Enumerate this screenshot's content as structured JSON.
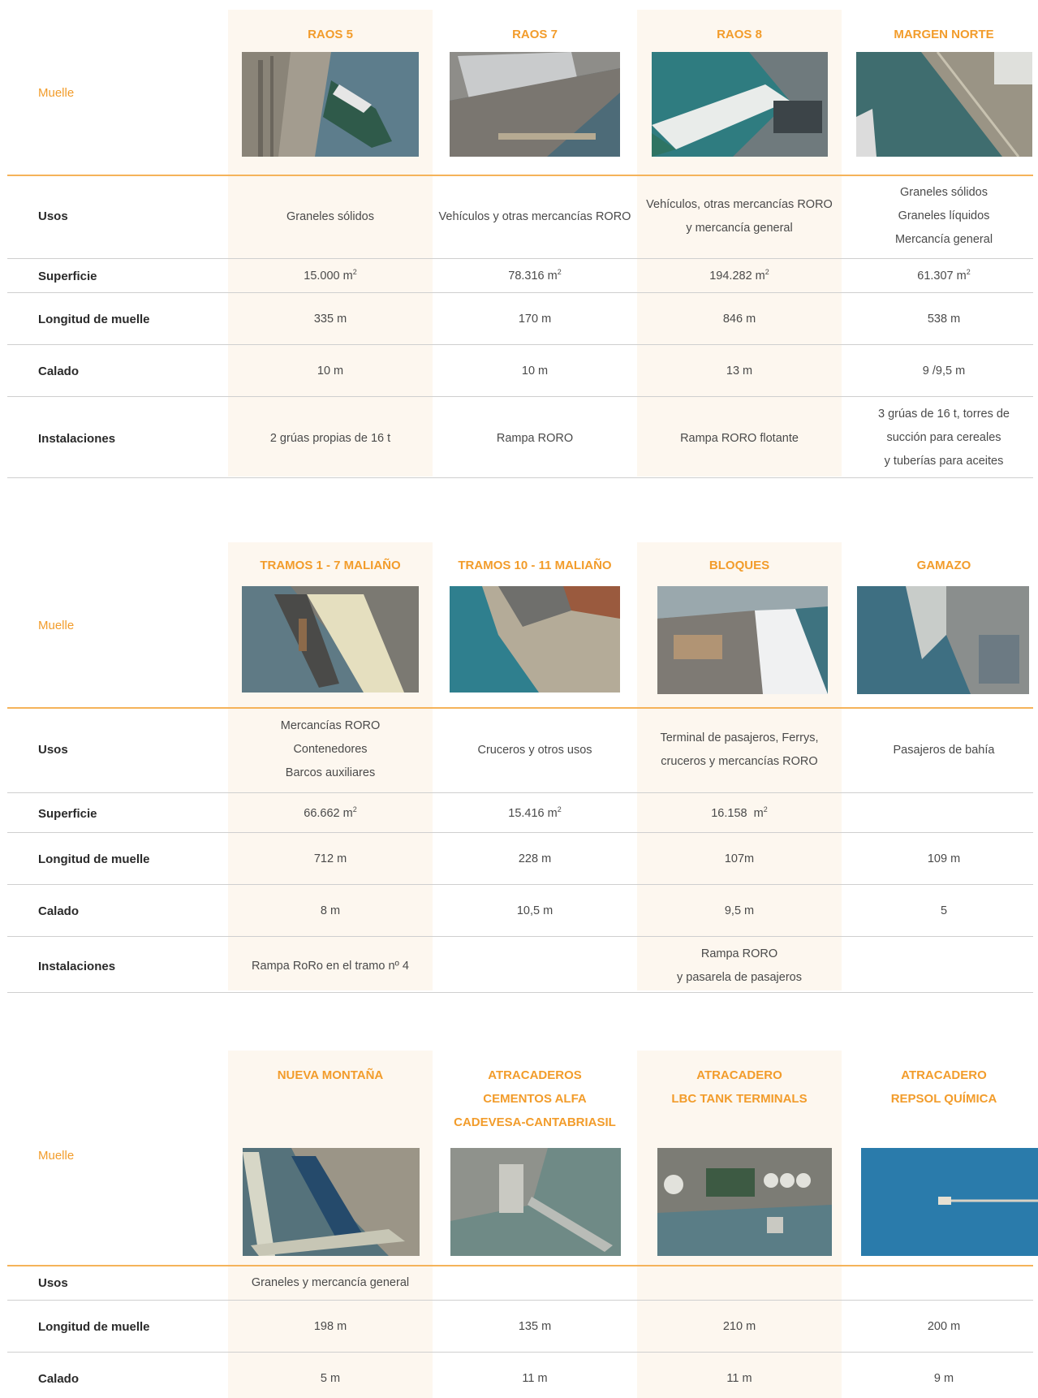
{
  "row_labels": {
    "muelle": "Muelle",
    "usos": "Usos",
    "superficie": "Superficie",
    "longitud": "Longitud de muelle",
    "calado": "Calado",
    "instalaciones": "Instalaciones"
  },
  "units": {
    "m2": "m",
    "sup2": "2"
  },
  "table1": {
    "docks": [
      {
        "title": "RAOS 5",
        "usos": [
          "Graneles sólidos"
        ],
        "superficie": "15.000 m",
        "longitud": "335 m",
        "calado": "10 m",
        "instalaciones": [
          "2 grúas propias de 16 t"
        ]
      },
      {
        "title": "RAOS 7",
        "usos": [
          "Vehículos y otras mercancías RORO"
        ],
        "superficie": "78.316 m",
        "longitud": "170 m",
        "calado": "10 m",
        "instalaciones": [
          "Rampa RORO"
        ]
      },
      {
        "title": "RAOS 8",
        "usos": [
          "Vehículos, otras mercancías RORO",
          "y mercancía general"
        ],
        "superficie": "194.282 m",
        "longitud": "846 m",
        "calado": "13 m",
        "instalaciones": [
          "Rampa RORO flotante"
        ]
      },
      {
        "title": "MARGEN NORTE",
        "usos": [
          "Graneles sólidos",
          "Graneles líquidos",
          "Mercancía general"
        ],
        "superficie": "61.307 m",
        "longitud": "538 m",
        "calado": "9 /9,5 m",
        "instalaciones": [
          "3 grúas de 16 t, torres de",
          "succión para cereales",
          "y tuberías para aceites"
        ]
      }
    ]
  },
  "table2": {
    "docks": [
      {
        "title": "TRAMOS 1 - 7 MALIAÑO",
        "usos": [
          "Mercancías RORO",
          "Contenedores",
          "Barcos auxiliares"
        ],
        "superficie": "66.662 m",
        "longitud": "712 m",
        "calado": "8 m",
        "instalaciones": [
          "Rampa RoRo en el tramo nº 4"
        ]
      },
      {
        "title": "TRAMOS 10 - 11 MALIAÑO",
        "usos": [
          "Cruceros y otros usos"
        ],
        "superficie": "15.416 m",
        "longitud": "228 m",
        "calado": "10,5 m",
        "instalaciones": []
      },
      {
        "title": "BLOQUES",
        "usos": [
          "Terminal de pasajeros, Ferrys,",
          "cruceros y mercancías RORO"
        ],
        "superficie": "16.158  m",
        "longitud": "107m",
        "calado": "9,5 m",
        "instalaciones": [
          "Rampa RORO",
          "y pasarela de pasajeros"
        ]
      },
      {
        "title": "GAMAZO",
        "usos": [
          "Pasajeros de bahía"
        ],
        "superficie": "",
        "longitud": "109 m",
        "calado": "5",
        "instalaciones": []
      }
    ]
  },
  "table3": {
    "docks": [
      {
        "title": [
          "NUEVA MONTAÑA"
        ],
        "longitud": "198 m",
        "calado": "5 m"
      },
      {
        "title": [
          "ATRACADEROS",
          "CEMENTOS ALFA",
          "CADEVESA-CANTABRIASIL"
        ],
        "longitud": "135 m",
        "calado": "11 m"
      },
      {
        "title": [
          "ATRACADERO",
          "LBC TANK TERMINALS"
        ],
        "longitud": "210 m",
        "calado": "11 m"
      },
      {
        "title": [
          "ATRACADERO",
          "REPSOL QUÍMICA"
        ],
        "longitud": "200 m",
        "calado": "9 m"
      }
    ],
    "usos_merged": "Graneles y mercancía general"
  }
}
